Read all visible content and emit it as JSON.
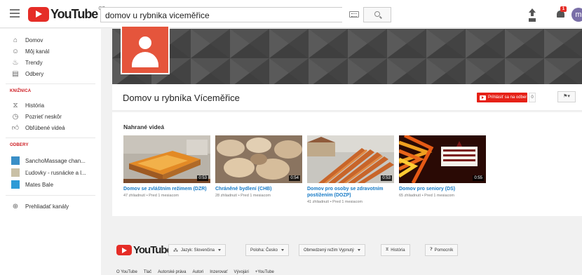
{
  "topbar": {
    "logo_text": "YouTube",
    "logo_cc": "CZ",
    "search_value": "domov u rybnika viceměřice",
    "notification_count": "1",
    "avatar_letter": "m"
  },
  "sidebar": {
    "nav": [
      {
        "label": "Domov",
        "icon": "home-icon"
      },
      {
        "label": "Môj kanál",
        "icon": "person-icon"
      },
      {
        "label": "Trendy",
        "icon": "flame-icon"
      },
      {
        "label": "Odbery",
        "icon": "subscriptions-icon"
      }
    ],
    "library_heading": "KNIŽNICA",
    "library": [
      {
        "label": "História",
        "icon": "hourglass-icon"
      },
      {
        "label": "Pozrieť neskôr",
        "icon": "clock-icon"
      },
      {
        "label": "Obľúbené videá",
        "icon": "thumbs-up-icon"
      }
    ],
    "subs_heading": "ODBERY",
    "subscriptions": [
      {
        "label": "SanchoMassage chan...",
        "color": "#3a8fc7"
      },
      {
        "label": "Ľudovky - rusnácke a l...",
        "color": "#c9c0a6"
      },
      {
        "label": "Mates Bale",
        "color": "#2f9bd6"
      }
    ],
    "browse_label": "Prehliadať kanály"
  },
  "channel": {
    "title": "Domov u rybníka Víceměřice",
    "subscribe_label": "Prihlásiť sa na odber",
    "subscriber_count": "0",
    "flag_label": "⚑▾",
    "section_title": "Nahrané videá",
    "videos": [
      {
        "title": "Domov se zvláštním režimem (DZR)",
        "meta": "47 zhliadnutí • Pred 1 mesiacom",
        "duration": "0:53"
      },
      {
        "title": "Chráněné bydlení (CHB)",
        "meta": "28 zhliadnutí • Pred 1 mesiacom",
        "duration": "0:54"
      },
      {
        "title": "Domov pro osoby se zdravotním postižením (DOZP)",
        "meta": "41 zhliadnutí • Pred 1 mesiacom",
        "duration": "0:53"
      },
      {
        "title": "Domov pro seniory (DS)",
        "meta": "65 zhliadnutí • Pred 1 mesiacom",
        "duration": "0:55"
      }
    ]
  },
  "footer": {
    "logo_text": "YouTube",
    "language": "Jazyk: Slovenčina",
    "location": "Poloha: Česko",
    "restricted": "Obmedzený režim Vypnutý",
    "history": "História",
    "help": "Pomocník",
    "links": [
      "O YouTube",
      "Tlač",
      "Autorské práva",
      "Autori",
      "Inzerovať",
      "Vývojári",
      "+YouTube"
    ]
  }
}
